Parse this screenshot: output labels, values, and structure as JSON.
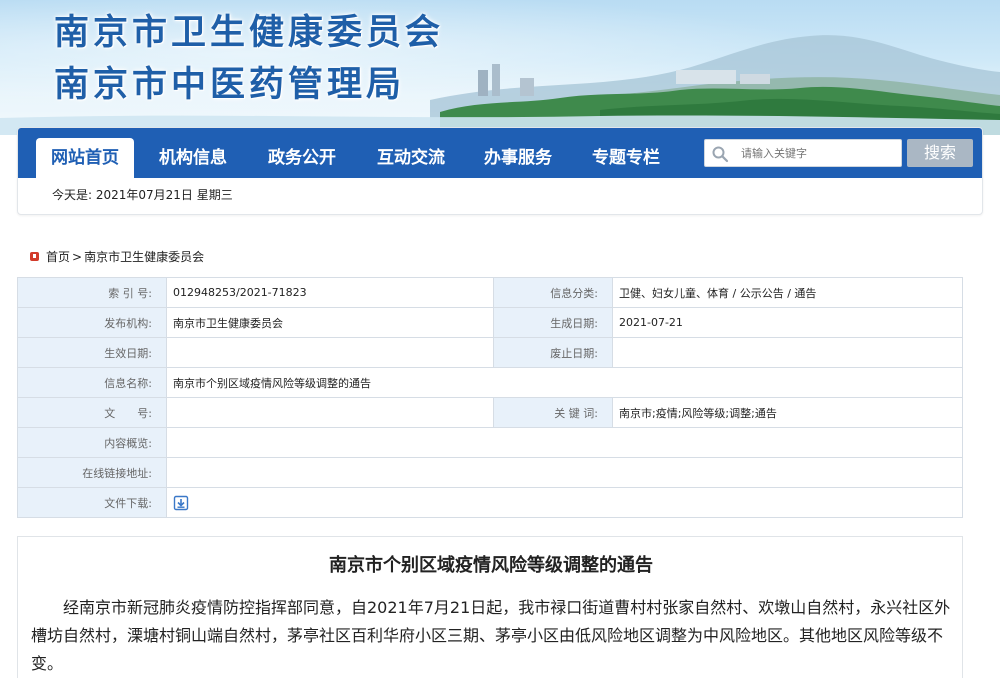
{
  "banner": {
    "title_line1": "南京市卫生健康委员会",
    "title_line2": "南京市中医药管理局"
  },
  "nav": {
    "items": [
      {
        "label": "网站首页",
        "active": true
      },
      {
        "label": "机构信息",
        "active": false
      },
      {
        "label": "政务公开",
        "active": false
      },
      {
        "label": "互动交流",
        "active": false
      },
      {
        "label": "办事服务",
        "active": false
      },
      {
        "label": "专题专栏",
        "active": false
      }
    ],
    "search_placeholder": "请输入关键字",
    "search_button": "搜索",
    "today": "今天是: 2021年07月21日 星期三"
  },
  "breadcrumb": {
    "home": "首页",
    "separator": ">",
    "current": "南京市卫生健康委员会"
  },
  "info": {
    "index_label": "索 引 号:",
    "index_value": "012948253/2021-71823",
    "category_label": "信息分类:",
    "category_value": "卫健、妇女儿童、体育 / 公示公告 / 通告",
    "publisher_label": "发布机构:",
    "publisher_value": "南京市卫生健康委员会",
    "created_label": "生成日期:",
    "created_value": "2021-07-21",
    "effective_label": "生效日期:",
    "effective_value": "",
    "abolished_label": "废止日期:",
    "abolished_value": "",
    "name_label": "信息名称:",
    "name_value": "南京市个别区域疫情风险等级调整的通告",
    "docno_label": "文　　号:",
    "docno_value": "",
    "keywords_label": "关 键 词:",
    "keywords_value": "南京市;疫情;风险等级;调整;通告",
    "summary_label": "内容概览:",
    "summary_value": "",
    "link_label": "在线链接地址:",
    "link_value": "",
    "download_label": "文件下载:"
  },
  "article": {
    "title": "南京市个别区域疫情风险等级调整的通告",
    "body": "经南京市新冠肺炎疫情防控指挥部同意，自2021年7月21日起，我市禄口街道曹村村张家自然村、欢墩山自然村，永兴社区外槽坊自然村，溧塘村铜山端自然村，茅亭社区百利华府小区三期、茅亭小区由低风险地区调整为中风险地区。其他地区风险等级不变。"
  },
  "colors": {
    "nav_blue": "#1f5fb4",
    "label_bg": "#e8f1fa",
    "title_blue": "#1f5fa8"
  }
}
